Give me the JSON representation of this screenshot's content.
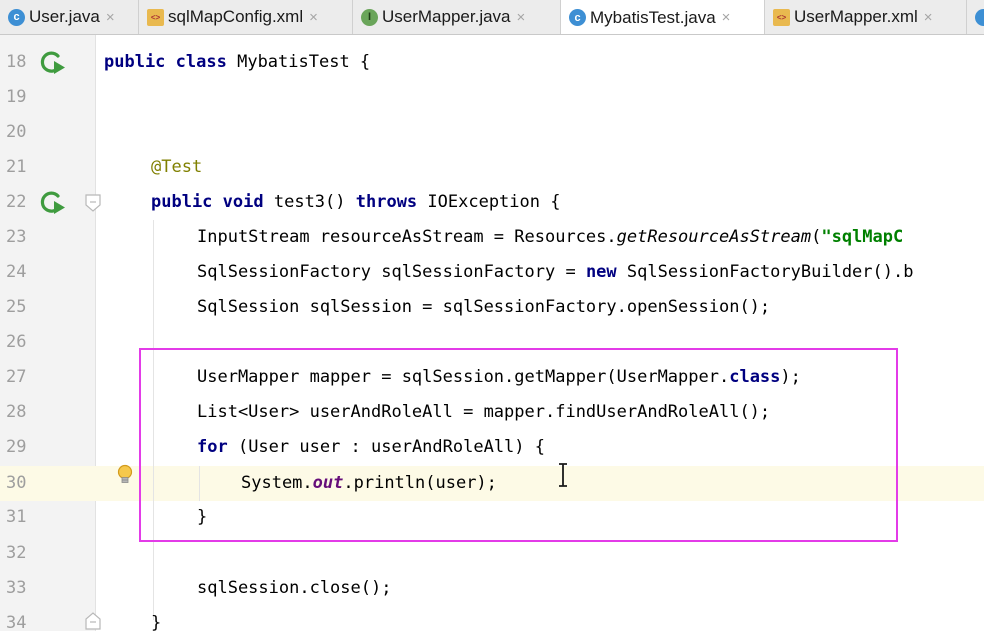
{
  "tabs": [
    {
      "label": "User.java",
      "icon": "class-icon",
      "icon_glyph": "c",
      "active": false
    },
    {
      "label": "sqlMapConfig.xml",
      "icon": "xml-file-icon",
      "icon_glyph": "<>",
      "active": false
    },
    {
      "label": "UserMapper.java",
      "icon": "interface-icon",
      "icon_glyph": "I",
      "active": false
    },
    {
      "label": "MybatisTest.java",
      "icon": "class-icon",
      "icon_glyph": "c",
      "active": true
    },
    {
      "label": "UserMapper.xml",
      "icon": "xml-file-icon",
      "icon_glyph": "<>",
      "active": false
    }
  ],
  "tab_close_glyph": "×",
  "editor": {
    "lines": [
      {
        "number": "18",
        "text": "public class MybatisTest {"
      },
      {
        "number": "19",
        "text": ""
      },
      {
        "number": "20",
        "text": ""
      },
      {
        "number": "21",
        "text": "@Test"
      },
      {
        "number": "22",
        "text": "public void test3() throws IOException {"
      },
      {
        "number": "23",
        "text": "InputStream resourceAsStream = Resources.getResourceAsStream(\"sqlMapC"
      },
      {
        "number": "24",
        "text": "SqlSessionFactory sqlSessionFactory = new SqlSessionFactoryBuilder().b"
      },
      {
        "number": "25",
        "text": "SqlSession sqlSession = sqlSessionFactory.openSession();"
      },
      {
        "number": "26",
        "text": ""
      },
      {
        "number": "27",
        "text": "UserMapper mapper = sqlSession.getMapper(UserMapper.class);"
      },
      {
        "number": "28",
        "text": "List<User> userAndRoleAll = mapper.findUserAndRoleAll();"
      },
      {
        "number": "29",
        "text": "for (User user : userAndRoleAll) {"
      },
      {
        "number": "30",
        "text": "System.out.println(user);"
      },
      {
        "number": "31",
        "text": "}"
      },
      {
        "number": "32",
        "text": ""
      },
      {
        "number": "33",
        "text": "sqlSession.close();"
      },
      {
        "number": "34",
        "text": "}"
      }
    ],
    "current_line": "30",
    "gutter_icons": [
      {
        "line": "18",
        "icon": "run-class-icon"
      },
      {
        "line": "22",
        "icon": "run-test-icon"
      },
      {
        "line": "22",
        "icon": "fold-icon"
      },
      {
        "line": "30",
        "icon": "lightbulb-icon"
      },
      {
        "line": "34",
        "icon": "fold-icon"
      }
    ]
  },
  "colors": {
    "keyword": "#000080",
    "annotation": "#808000",
    "string": "#008000",
    "field": "#660e7a",
    "highlight_box": "#e33be8",
    "current_line_bg": "#fdfae6"
  }
}
